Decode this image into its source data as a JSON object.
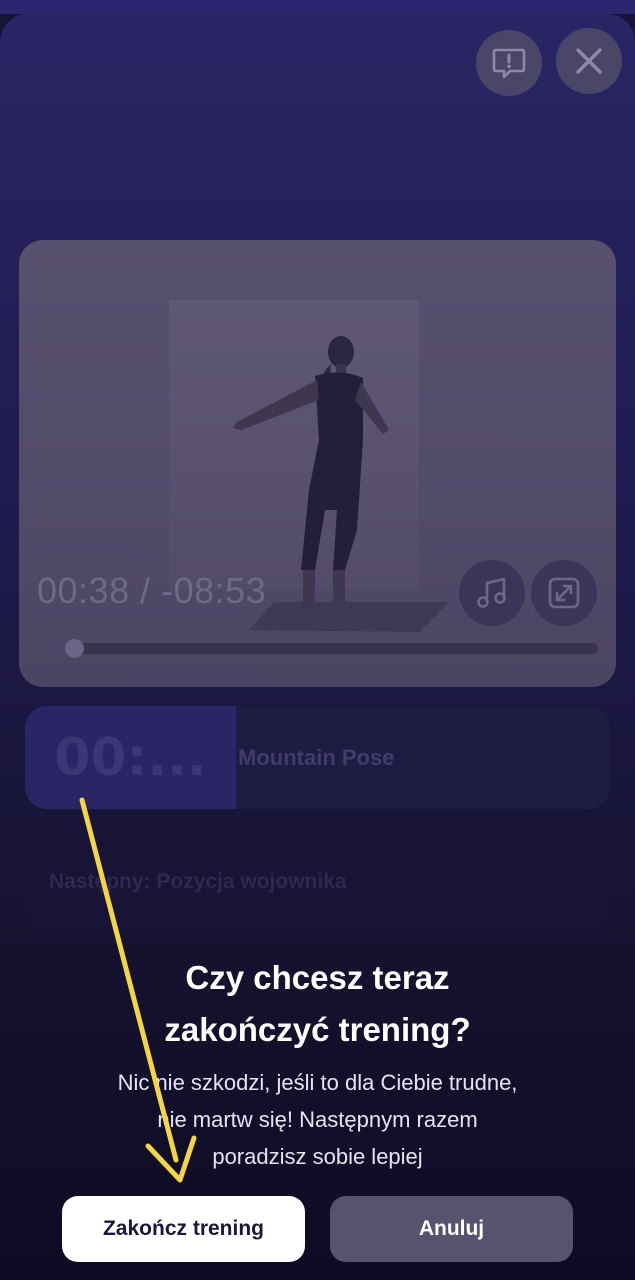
{
  "topbar": {
    "report_icon": "report-issue-icon",
    "close_icon": "close-icon"
  },
  "video": {
    "elapsed": "00:38",
    "separator": "/",
    "remaining": "-08:53",
    "progress": 0.066,
    "music_icon": "music-note-icon",
    "fullscreen_icon": "fullscreen-icon"
  },
  "exercise": {
    "timer": "00:...",
    "name": "Mountain Pose"
  },
  "next": {
    "label": "Następny: Pozycja wojownika"
  },
  "dialog": {
    "title_line1": "Czy chcesz teraz",
    "title_line2": "zakończyć trening?",
    "message_line1": "Nic nie szkodzi, jeśli to dla Ciebie trudne,",
    "message_line2": "nie martw się! Następnym razem",
    "message_line3": "poradzisz sobie lepiej"
  },
  "buttons": {
    "end_label": "Zakończ trening",
    "cancel_label": "Anuluj"
  },
  "annotation": {
    "arrow_color": "#f5d547"
  }
}
